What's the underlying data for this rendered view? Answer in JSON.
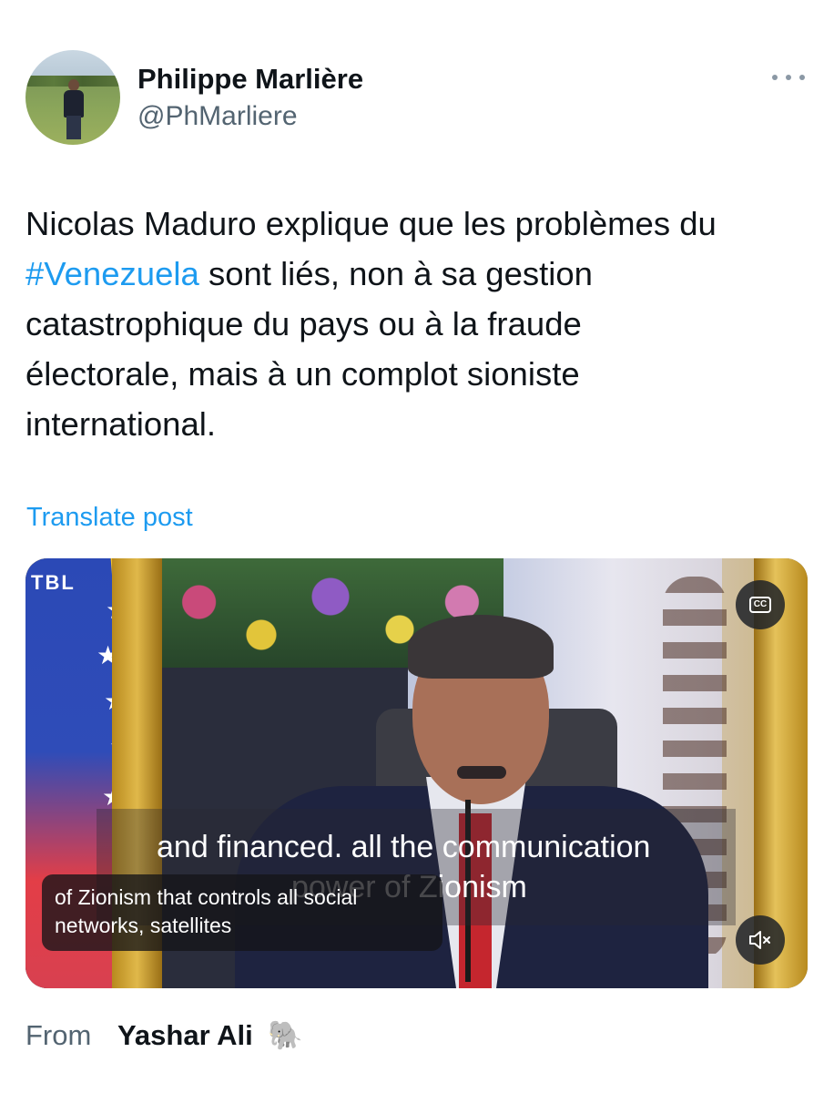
{
  "author": {
    "name": "Philippe Marlière",
    "handle": "@PhMarliere",
    "avatar_icon": "profile-photo"
  },
  "more_icon": "ellipsis-icon",
  "tweet": {
    "lines": [
      "Nicolas Maduro explique que les problèmes du",
      "#Venezuela",
      " sont liés, non à sa gestion",
      "catastrophique du pays ou à la fraude",
      "électorale, mais à un complot sioniste",
      "international."
    ],
    "hashtag_color": "#1d9bf0"
  },
  "translate_label": "Translate post",
  "media": {
    "logo_text": "TBL",
    "caption_main_1": "and financed. all the communication",
    "caption_main_2": "power of Zionism",
    "caption_small_1": "of Zionism that controls all social",
    "caption_small_2": "networks, satellites",
    "cc_label": "CC",
    "cc_icon": "closed-captions-icon",
    "mute_icon": "speaker-muted-icon"
  },
  "quote": {
    "from_label": "From",
    "user": "Yashar Ali",
    "emoji": "🐘"
  }
}
